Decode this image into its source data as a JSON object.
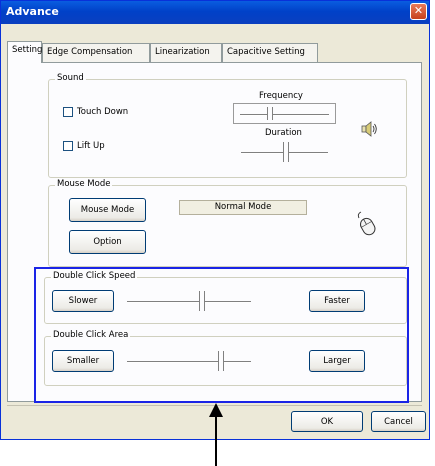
{
  "window": {
    "title": "Advance",
    "close_glyph": "✕"
  },
  "tabs": [
    {
      "label": "Setting"
    },
    {
      "label": "Edge Compensation"
    },
    {
      "label": "Linearization"
    },
    {
      "label": "Capacitive Setting"
    }
  ],
  "sound": {
    "legend": "Sound",
    "touch_down": {
      "label": "Touch Down",
      "checked": false
    },
    "lift_up": {
      "label": "Lift Up",
      "checked": false
    },
    "frequency_label": "Frequency",
    "frequency_level": 0.35,
    "duration_label": "Duration",
    "duration_level": 0.5,
    "icon": "speaker-icon"
  },
  "mouse_mode": {
    "legend": "Mouse Mode",
    "mode_button": "Mouse Mode",
    "option_button": "Option",
    "current_mode": "Normal Mode",
    "icon": "mouse-icon"
  },
  "double_click_speed": {
    "legend": "Double Click Speed",
    "slower_button": "Slower",
    "faster_button": "Faster",
    "level": 0.6
  },
  "double_click_area": {
    "legend": "Double Click Area",
    "smaller_button": "Smaller",
    "larger_button": "Larger",
    "level": 0.75
  },
  "footer": {
    "ok_button": "OK",
    "cancel_button": "Cancel"
  },
  "annotation": {
    "highlight_color": "#1a24e6"
  }
}
